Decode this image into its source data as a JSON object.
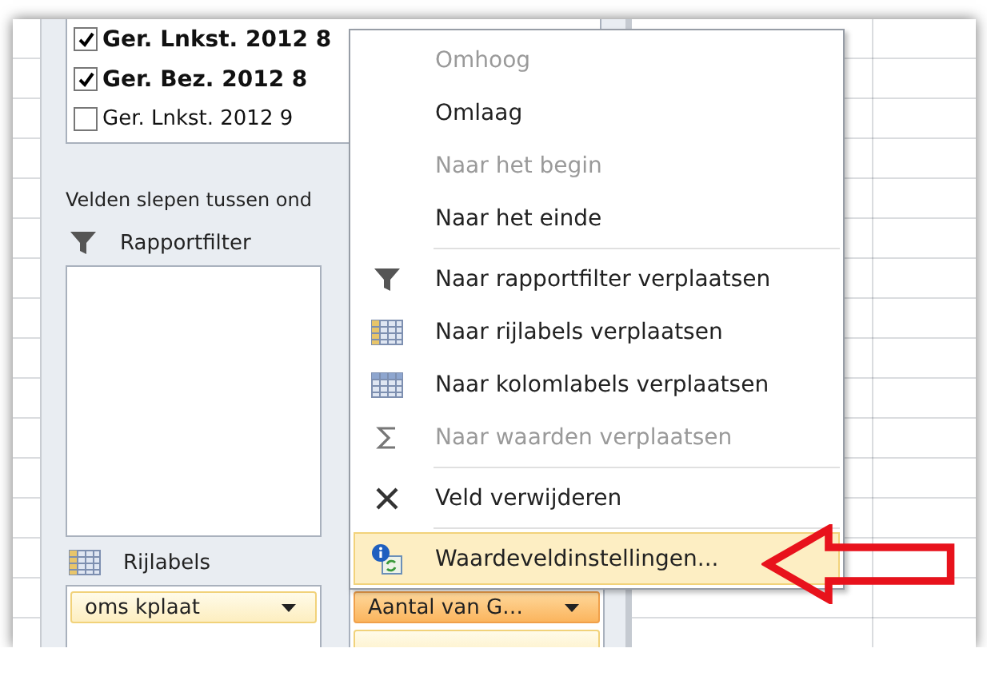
{
  "field_list": {
    "items": [
      {
        "label": "Ger. Lnkst. 2012 8",
        "checked": true
      },
      {
        "label": "Ger. Bez. 2012 8",
        "checked": true
      },
      {
        "label": "Ger. Lnkst. 2012 9",
        "checked": false
      }
    ]
  },
  "instruction": "Velden slepen tussen ond",
  "areas": [
    {
      "kind": "filter",
      "title": "Rapportfilter"
    },
    {
      "kind": "columns"
    },
    {
      "kind": "rows",
      "title": "Rijlabels",
      "fields": [
        {
          "label": "oms kplaat",
          "active": false
        }
      ]
    },
    {
      "kind": "values",
      "fields": [
        {
          "label": "Aantal van G…",
          "active": true
        },
        {
          "active": false
        }
      ]
    }
  ],
  "context_menu": {
    "items": [
      {
        "kind": "plain",
        "label": "Omhoog",
        "disabled": true,
        "selected": false
      },
      {
        "kind": "plain",
        "label": "Omlaag",
        "disabled": false,
        "selected": false
      },
      {
        "kind": "plain",
        "label": "Naar het begin",
        "disabled": true,
        "selected": false
      },
      {
        "kind": "plain",
        "label": "Naar het einde",
        "disabled": false,
        "selected": false
      },
      {
        "kind": "separator"
      },
      {
        "kind": "filter",
        "label": "Naar rapportfilter verplaatsen",
        "disabled": false,
        "selected": false
      },
      {
        "kind": "rows",
        "label": "Naar rijlabels verplaatsen",
        "disabled": false,
        "selected": false
      },
      {
        "kind": "columns",
        "label": "Naar kolomlabels verplaatsen",
        "disabled": false,
        "selected": false
      },
      {
        "kind": "values",
        "label": "Naar waarden verplaatsen",
        "disabled": true,
        "selected": false
      },
      {
        "kind": "separator"
      },
      {
        "kind": "remove",
        "label": "Veld verwijderen",
        "disabled": false,
        "selected": false
      },
      {
        "kind": "separator"
      },
      {
        "kind": "settings",
        "label": "Waardeveldinstellingen...",
        "disabled": false,
        "selected": true
      }
    ]
  }
}
